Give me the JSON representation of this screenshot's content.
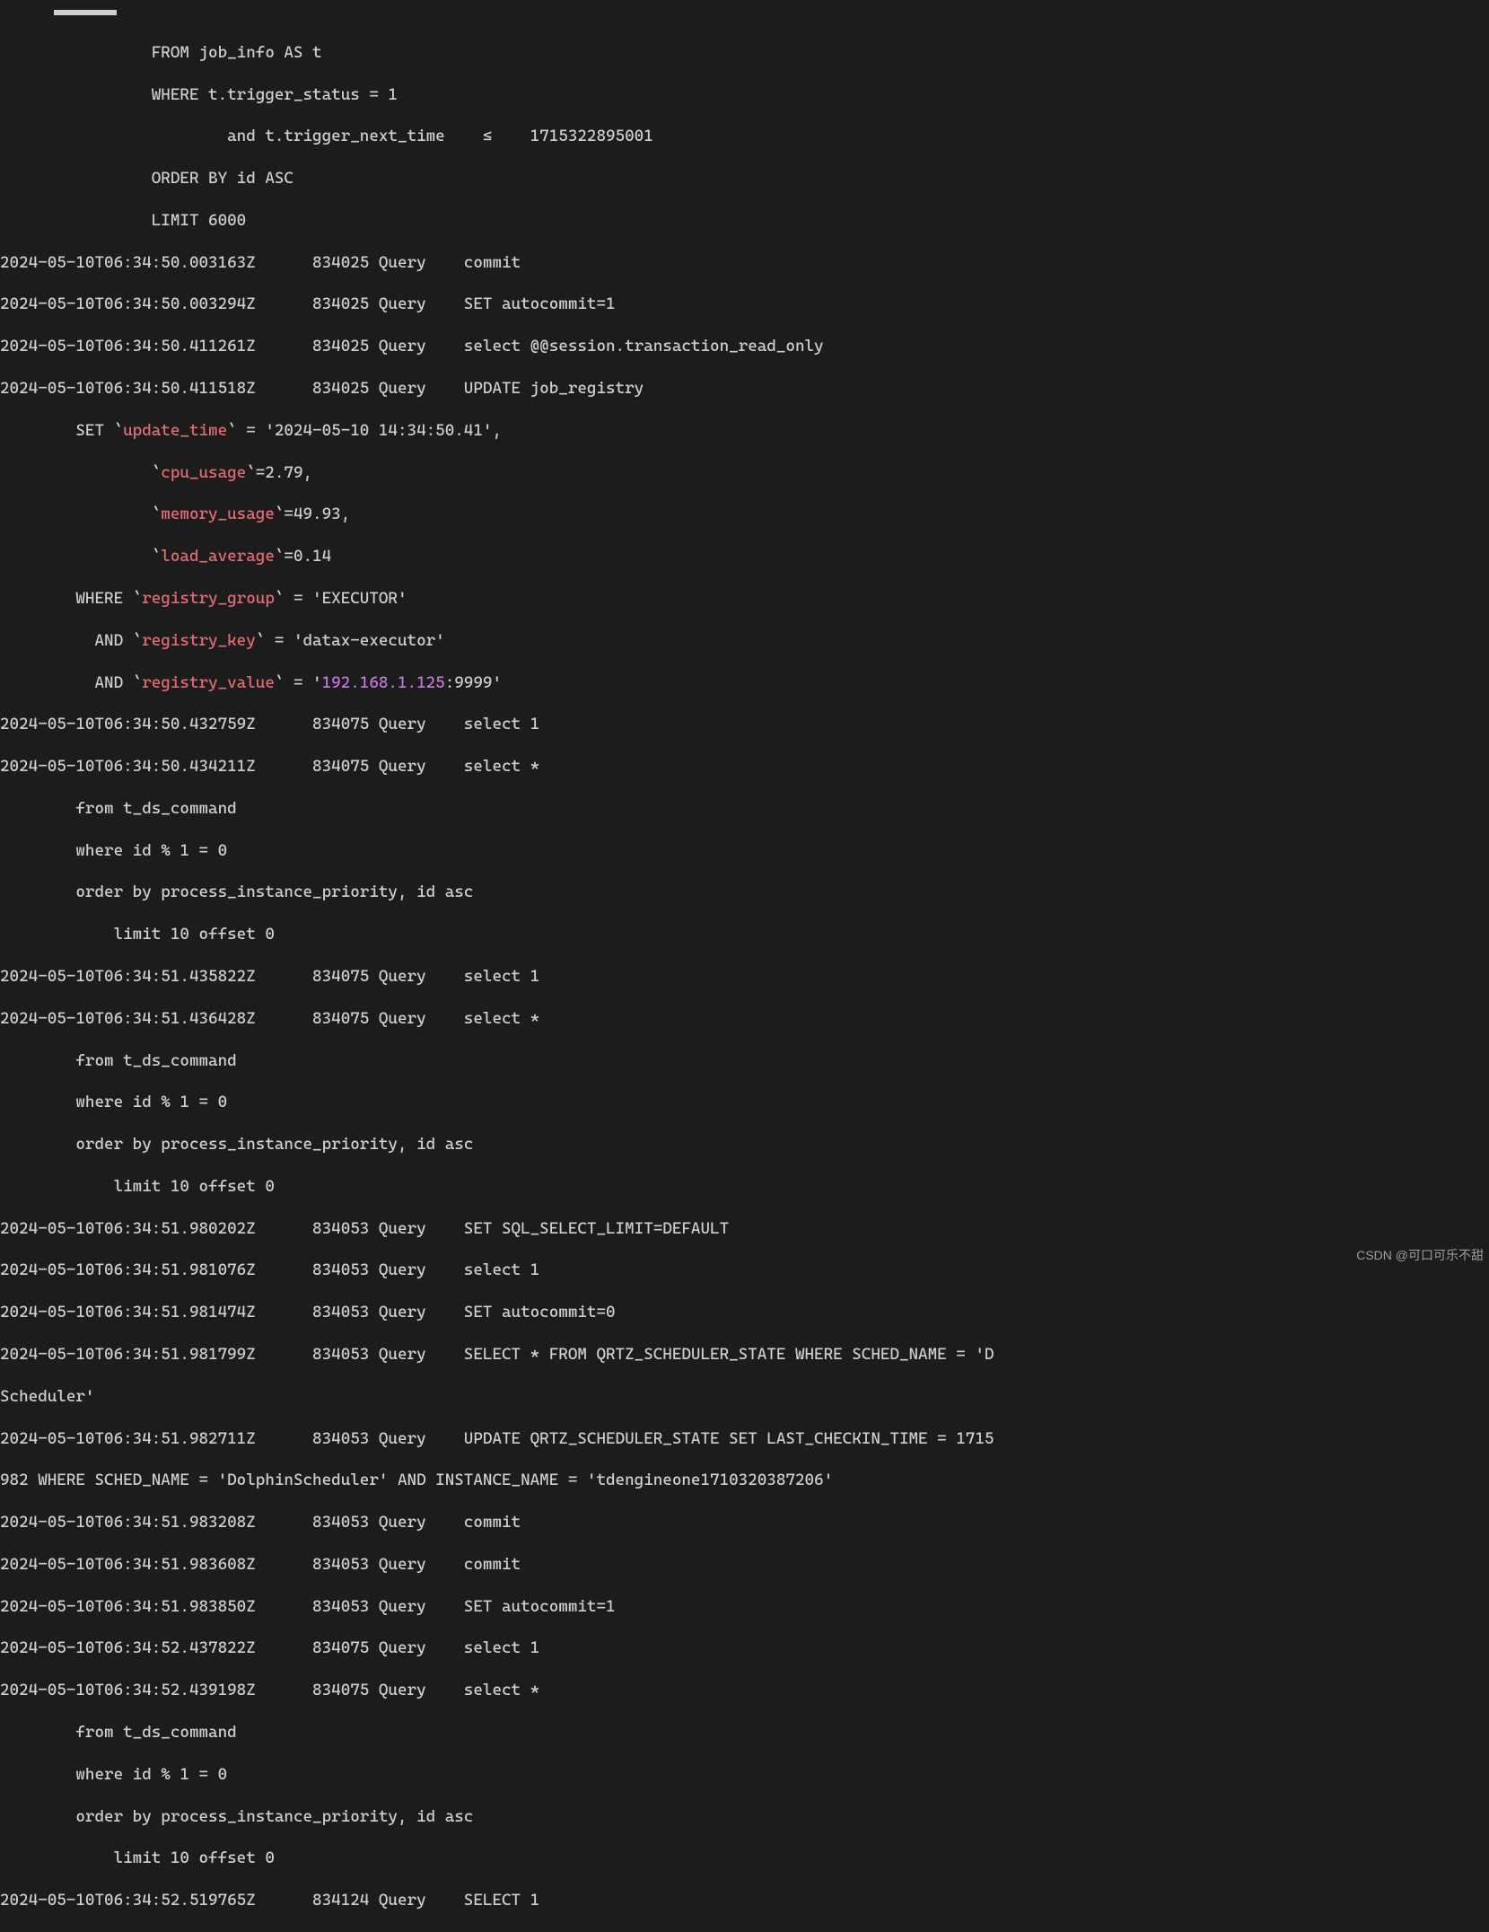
{
  "watermark": "CSDN @可口可乐不甜",
  "lines": [
    {
      "a": "                FROM job_info AS t"
    },
    {
      "a": "                WHERE t.trigger_status = 1"
    },
    {
      "a": "                        and t.trigger_next_time    ≤    1715322895001"
    },
    {
      "a": "                ORDER BY id ASC"
    },
    {
      "a": "                LIMIT 6000"
    },
    {
      "a": "2024-05-10T06:34:50.003163Z      834025 Query    commit"
    },
    {
      "a": "2024-05-10T06:34:50.003294Z      834025 Query    SET autocommit=1"
    },
    {
      "a": "2024-05-10T06:34:50.411261Z      834025 Query    select @@session.transaction_read_only"
    },
    {
      "a": "2024-05-10T06:34:50.411518Z      834025 Query    UPDATE job_registry"
    },
    {
      "a": "        SET `",
      "b": "update_time",
      "c": "` = '2024-05-10 14:34:50.41',"
    },
    {
      "a": "                `",
      "b": "cpu_usage",
      "c": "`=2.79,"
    },
    {
      "a": "                `",
      "b": "memory_usage",
      "c": "`=49.93,"
    },
    {
      "a": "                `",
      "b": "load_average",
      "c": "`=0.14"
    },
    {
      "a": "        WHERE `",
      "b": "registry_group",
      "c": "` = 'EXECUTOR'"
    },
    {
      "a": "          AND `",
      "b": "registry_key",
      "c": "` = 'datax-executor'"
    },
    {
      "a": "          AND `",
      "b": "registry_value",
      "c": "` = '",
      "d": "192.168.1.125",
      "e": ":9999'"
    },
    {
      "a": "2024-05-10T06:34:50.432759Z      834075 Query    select 1"
    },
    {
      "a": "2024-05-10T06:34:50.434211Z      834075 Query    select *"
    },
    {
      "a": "        from t_ds_command"
    },
    {
      "a": "        where id % 1 = 0"
    },
    {
      "a": "        order by process_instance_priority, id asc"
    },
    {
      "a": "            limit 10 offset 0"
    },
    {
      "a": "2024-05-10T06:34:51.435822Z      834075 Query    select 1"
    },
    {
      "a": "2024-05-10T06:34:51.436428Z      834075 Query    select *"
    },
    {
      "a": "        from t_ds_command"
    },
    {
      "a": "        where id % 1 = 0"
    },
    {
      "a": "        order by process_instance_priority, id asc"
    },
    {
      "a": "            limit 10 offset 0"
    },
    {
      "a": "2024-05-10T06:34:51.980202Z      834053 Query    SET SQL_SELECT_LIMIT=DEFAULT"
    },
    {
      "a": "2024-05-10T06:34:51.981076Z      834053 Query    select 1"
    },
    {
      "a": "2024-05-10T06:34:51.981474Z      834053 Query    SET autocommit=0"
    },
    {
      "a": "2024-05-10T06:34:51.981799Z      834053 Query    SELECT * FROM QRTZ_SCHEDULER_STATE WHERE SCHED_NAME = 'D"
    },
    {
      "a": "Scheduler'"
    },
    {
      "a": "2024-05-10T06:34:51.982711Z      834053 Query    UPDATE QRTZ_SCHEDULER_STATE SET LAST_CHECKIN_TIME = 1715"
    },
    {
      "a": "982 WHERE SCHED_NAME = 'DolphinScheduler' AND INSTANCE_NAME = 'tdengineone1710320387206'"
    },
    {
      "a": "2024-05-10T06:34:51.983208Z      834053 Query    commit"
    },
    {
      "a": "2024-05-10T06:34:51.983608Z      834053 Query    commit"
    },
    {
      "a": "2024-05-10T06:34:51.983850Z      834053 Query    SET autocommit=1"
    },
    {
      "a": "2024-05-10T06:34:52.437822Z      834075 Query    select 1"
    },
    {
      "a": "2024-05-10T06:34:52.439198Z      834075 Query    select *"
    },
    {
      "a": "        from t_ds_command"
    },
    {
      "a": "        where id % 1 = 0"
    },
    {
      "a": "        order by process_instance_priority, id asc"
    },
    {
      "a": "            limit 10 offset 0"
    },
    {
      "a": "2024-05-10T06:34:52.519765Z      834124 Query    SELECT 1"
    }
  ]
}
